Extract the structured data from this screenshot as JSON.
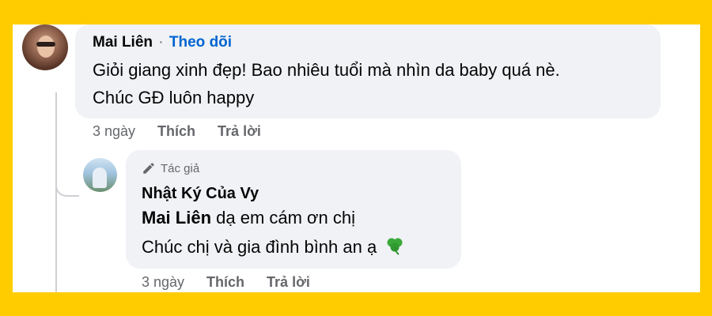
{
  "comment": {
    "author": "Mai Liên",
    "separator": "·",
    "follow_label": "Theo dõi",
    "line1": "Giỏi giang xinh đẹp! Bao nhiêu tuổi mà nhìn da baby quá nè.",
    "line2": "Chúc GĐ luôn happy",
    "time": "3 ngày",
    "like_label": "Thích",
    "reply_label": "Trả lời"
  },
  "reply": {
    "badge_label": "Tác giả",
    "author": "Nhật Ký Của Vy",
    "mention": "Mai Liên",
    "line1_rest": " dạ em cám ơn chị",
    "line2": "Chúc chị và gia đình bình an ạ",
    "emoji_icon": "shamrock-icon",
    "time": "3 ngày",
    "like_label": "Thích",
    "reply_label": "Trả lời"
  },
  "colors": {
    "background": "#ffcc00",
    "bubble": "#f0f2f5",
    "follow_link": "#0064d1",
    "meta_text": "#65676b"
  }
}
